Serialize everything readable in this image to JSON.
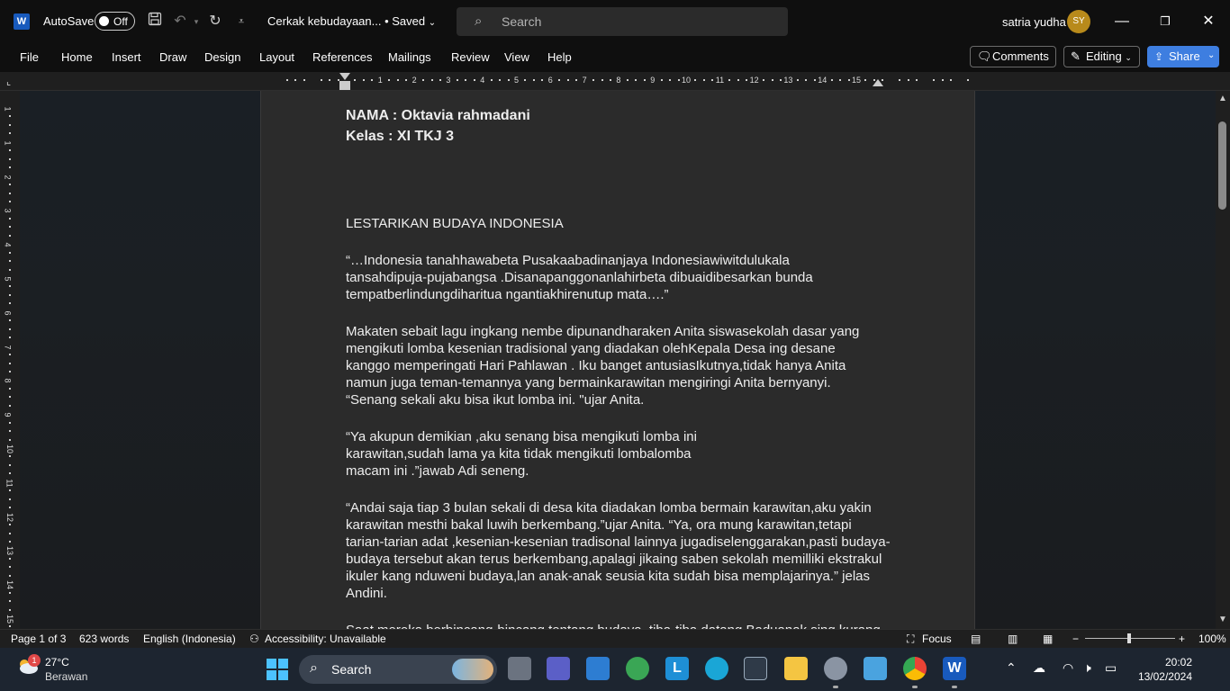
{
  "titlebar": {
    "app_logo": "W",
    "autosave_label": "AutoSave",
    "autosave_state": "Off",
    "doc_title": "Cerkak kebudayaan... • Saved",
    "search_placeholder": "Search",
    "username": "satria yudha",
    "avatar_initials": "SY"
  },
  "menu": {
    "file": "File",
    "home": "Home",
    "insert": "Insert",
    "draw": "Draw",
    "design": "Design",
    "layout": "Layout",
    "references": "References",
    "mailings": "Mailings",
    "review": "Review",
    "view": "View",
    "help": "Help",
    "comments": "Comments",
    "editing": "Editing",
    "share": "Share"
  },
  "ruler": {
    "numbers": [
      "1",
      "2",
      "3",
      "4",
      "5",
      "6",
      "7",
      "8",
      "9",
      "10",
      "11",
      "12",
      "13",
      "14",
      "15"
    ],
    "vnumbers": [
      "1",
      "1",
      "2",
      "3",
      "4",
      "5",
      "6",
      "7",
      "8",
      "9",
      "10",
      "11",
      "12",
      "13",
      "14",
      "15"
    ]
  },
  "document": {
    "line_name": "NAMA : Oktavia rahmadani",
    "line_class": "Kelas : XI TKJ 3",
    "title": "LESTARIKAN BUDAYA INDONESIA",
    "para1": [
      "“…Indonesia tanahhawabeta Pusakaabadinanjaya Indonesiawiwitdulukala",
      "tansahdipuja-pujabangsa .Disanapanggonanlahirbeta dibuaidibesarkan bunda",
      "tempatberlindungdiharitua ngantiakhirenutup mata….”"
    ],
    "para2": [
      "Makaten sebait lagu ingkang nembe dipunandharaken Anita siswasekolah dasar yang",
      "mengikuti lomba kesenian tradisional yang diadakan olehKepala Desa ing desane",
      "kanggo memperingati Hari Pahlawan . Iku banget antusiasIkutnya,tidak hanya Anita",
      "namun juga teman-temannya yang bermainkarawitan mengiringi Anita bernyanyi.",
      "“Senang sekali aku bisa ikut lomba ini. \"ujar Anita."
    ],
    "para3": [
      "“Ya akupun demikian ,aku senang bisa mengikuti lomba ini",
      "karawitan,sudah lama ya kita tidak mengikuti lombalomba",
      "macam ini .”jawab Adi seneng."
    ],
    "para4": [
      "“Andai saja tiap 3 bulan sekali di desa kita diadakan lomba bermain karawitan,aku yakin",
      "karawitan mesthi bakal luwih berkembang.”ujar Anita. “Ya, ora mung karawitan,tetapi",
      "tarian-tarian adat ,kesenian-kesenian tradisonal lainnya jugadiselenggarakan,pasti budaya-",
      "budaya tersebut akan terus berkembang,apalagi jikaing saben sekolah memilliki ekstrakul",
      "ikuler kang nduweni budaya,lan anak-anak seusia kita sudah bisa memplajarinya.” jelas",
      "Andini."
    ],
    "para5": [
      "Saat mereka berbincang-bincang tentang budaya, tiba-tiba datang Baduanak sing kurang"
    ]
  },
  "statusbar": {
    "page": "Page 1 of 3",
    "words": "623 words",
    "language": "English (Indonesia)",
    "accessibility": "Accessibility: Unavailable",
    "focus": "Focus",
    "zoom": "100%"
  },
  "taskbar": {
    "weather_badge": "1",
    "temperature": "27°C",
    "weather": "Berawan",
    "search": "Search",
    "time": "20:02",
    "date": "13/02/2024"
  },
  "colors": {
    "accent": "#3e7ee0",
    "page_bg": "#2b2b2b",
    "titlebar_bg": "#0f0f0f",
    "taskbar_bg": "#1d2530"
  }
}
